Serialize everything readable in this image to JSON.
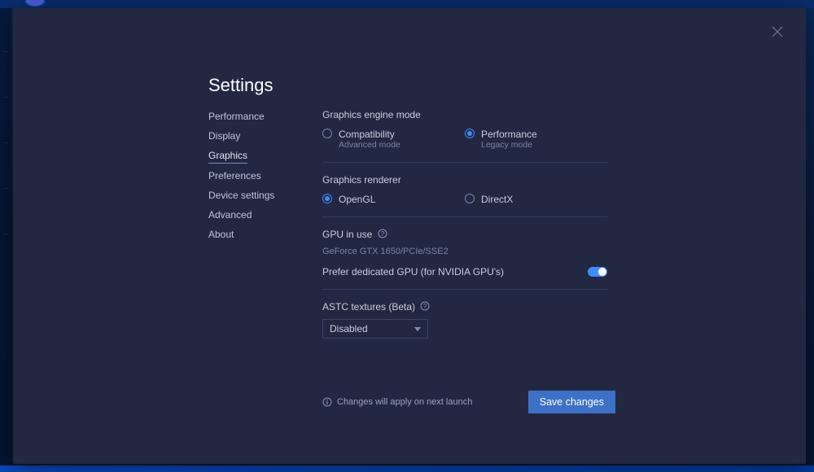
{
  "title": "Settings",
  "sidebar": {
    "items": [
      {
        "label": "Performance"
      },
      {
        "label": "Display"
      },
      {
        "label": "Graphics"
      },
      {
        "label": "Preferences"
      },
      {
        "label": "Device settings"
      },
      {
        "label": "Advanced"
      },
      {
        "label": "About"
      }
    ],
    "active_index": 2
  },
  "sections": {
    "engine_mode": {
      "label": "Graphics engine mode",
      "compatibility": {
        "label": "Compatibility",
        "sub": "Advanced mode"
      },
      "performance": {
        "label": "Performance",
        "sub": "Legacy mode"
      },
      "selected": "performance"
    },
    "renderer": {
      "label": "Graphics renderer",
      "opengl": {
        "label": "OpenGL"
      },
      "directx": {
        "label": "DirectX"
      },
      "selected": "opengl"
    },
    "gpu": {
      "label": "GPU in use",
      "name": "GeForce GTX 1650/PCIe/SSE2",
      "prefer_label": "Prefer dedicated GPU (for NVIDIA GPU's)",
      "prefer_on": true
    },
    "astc": {
      "label": "ASTC textures (Beta)",
      "value": "Disabled"
    }
  },
  "footer": {
    "note": "Changes will apply on next launch",
    "save": "Save changes"
  }
}
